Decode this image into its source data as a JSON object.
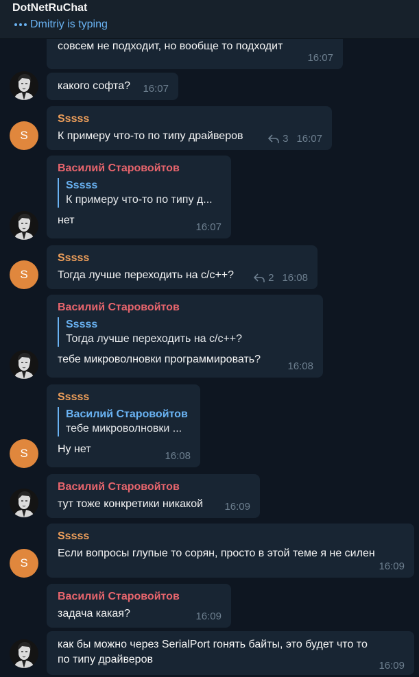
{
  "header": {
    "title": "DotNetRuChat",
    "status": "Dmitriy is typing"
  },
  "messages": [
    {
      "text": "совсем не подходит, но вообще то подходит",
      "time": "16:07"
    },
    {
      "text": "какого софта?",
      "time": "16:07"
    },
    {
      "author": "Sssss",
      "text": "К примеру что-то по типу драйверов",
      "replies": "3",
      "time": "16:07"
    },
    {
      "author": "Василий Старовойтов",
      "quote_author": "Sssss",
      "quote_text": "К примеру что-то по типу д...",
      "text": "нет",
      "time": "16:07"
    },
    {
      "author": "Sssss",
      "text": "Тогда лучше переходить на c/c++?",
      "replies": "2",
      "time": "16:08"
    },
    {
      "author": "Василий Старовойтов",
      "quote_author": "Sssss",
      "quote_text": "Тогда лучше переходить на c/c++?",
      "text": "тебе микроволновки программировать?",
      "time": "16:08"
    },
    {
      "author": "Sssss",
      "quote_author": "Василий Старовойтов",
      "quote_text": "тебе микроволновки ...",
      "text": "Ну нет",
      "time": "16:08"
    },
    {
      "author": "Василий Старовойтов",
      "text": "тут тоже конкретики никакой",
      "time": "16:09"
    },
    {
      "author": "Sssss",
      "text": "Если вопросы глупые то сорян, просто в этой теме я не силен",
      "time": "16:09"
    },
    {
      "author": "Василий Старовойтов",
      "text": "задача какая?",
      "time": "16:09"
    },
    {
      "text": "как бы можно через SerialPort гонять байты, это будет что то по типу драйверов",
      "time": "16:09"
    }
  ],
  "avatar_letter": "S",
  "colors": {
    "background": "#0e1621",
    "bubble": "#182533",
    "accent": "#6ab3f3",
    "author_orange": "#f0a05b",
    "author_red": "#e8656d",
    "avatar_orange": "#e0873d"
  },
  "icons": {
    "typing": "typing-dots-icon",
    "reply": "reply-arrow-icon"
  }
}
